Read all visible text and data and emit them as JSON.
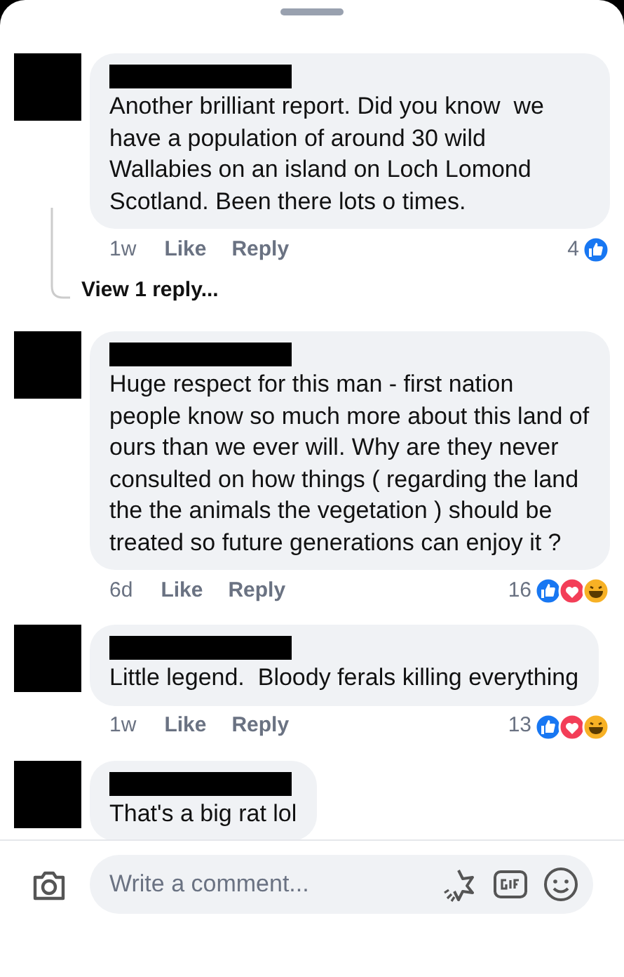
{
  "comments": [
    {
      "text": "Another brilliant report. Did you know  we have a population of around 30 wild Wallabies on an island on Loch Lomond Scotland. Been there lots o times.",
      "time": "1w",
      "like": "Like",
      "reply": "Reply",
      "count": "4",
      "reactions": [
        {
          "kind": "like"
        }
      ],
      "view_replies": "View 1 reply..."
    },
    {
      "text": "Huge respect for this man - first nation people know so much more about this land of ours than we ever will. Why are they never consulted on how things ( regarding the land the the animals the vegetation ) should be treated so future generations can enjoy it ?",
      "time": "6d",
      "like": "Like",
      "reply": "Reply",
      "count": "16",
      "reactions": [
        {
          "kind": "like"
        },
        {
          "kind": "love"
        },
        {
          "kind": "haha"
        }
      ]
    },
    {
      "text": "Little legend.  Bloody ferals killing everything",
      "time": "1w",
      "like": "Like",
      "reply": "Reply",
      "count": "13",
      "reactions": [
        {
          "kind": "like"
        },
        {
          "kind": "love"
        },
        {
          "kind": "haha"
        }
      ]
    },
    {
      "text": "That's a big rat lol"
    }
  ],
  "composer": {
    "placeholder": "Write a comment..."
  }
}
